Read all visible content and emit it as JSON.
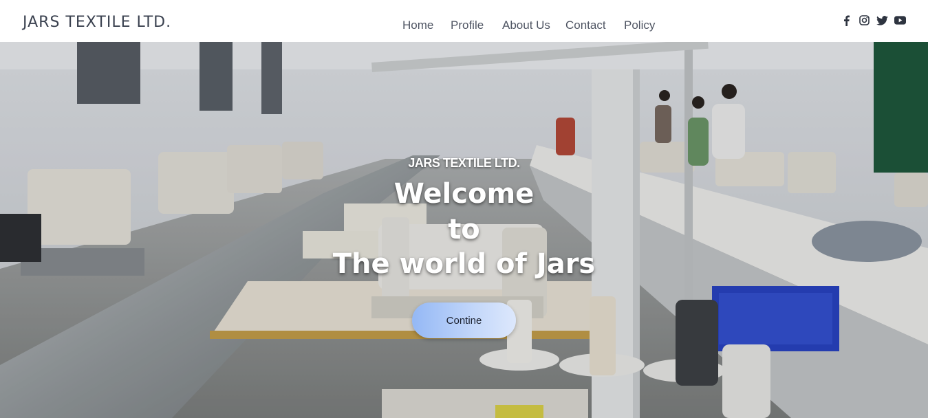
{
  "header": {
    "brand": "JARS TEXTILE LTD.",
    "nav": [
      "Home",
      "Profile",
      "About Us",
      "Contact",
      "Policy"
    ],
    "social_icons": [
      "facebook-icon",
      "instagram-icon",
      "twitter-icon",
      "youtube-icon"
    ]
  },
  "hero": {
    "tagline": "JARS TEXTILE LTD.",
    "headline": [
      "Welcome",
      "to",
      "The world of Jars"
    ],
    "cta_label": "Contine",
    "background": "textile factory floor with rows of sewing machines"
  },
  "colors": {
    "nav_text": "#4f5563",
    "brand_text": "#3b4250",
    "cta_gradient_start": "#94b8f5",
    "cta_gradient_end": "#dde8fc"
  }
}
